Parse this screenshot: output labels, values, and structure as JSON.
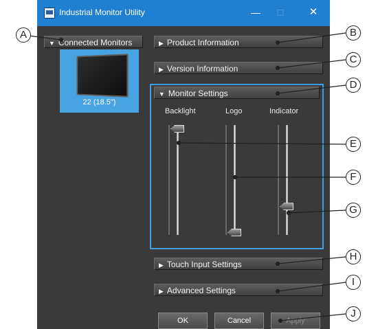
{
  "window": {
    "title": "Industrial Monitor Utility"
  },
  "window_controls": {
    "minimize": "—",
    "maximize": "□",
    "close": "✕"
  },
  "sections": {
    "connected_monitors": "Connected Monitors",
    "product_information": "Product Information",
    "version_information": "Version Information",
    "monitor_settings": "Monitor Settings",
    "touch_input_settings": "Touch Input Settings",
    "advanced_settings": "Advanced Settings"
  },
  "monitor": {
    "caption": "22 (18.5\")",
    "selected": true
  },
  "monitor_settings": {
    "sliders": [
      {
        "label": "Backlight",
        "level": 1.0
      },
      {
        "label": "Logo",
        "level": 0.0
      },
      {
        "label": "Indicator",
        "level": 0.25
      }
    ]
  },
  "buttons": {
    "ok": "OK",
    "cancel": "Cancel",
    "apply": "Apply"
  },
  "callouts": [
    "A",
    "B",
    "C",
    "D",
    "E",
    "F",
    "G",
    "H",
    "I",
    "J"
  ],
  "colors": {
    "titlebar": "#1f7fd0",
    "window_bg": "#3a3a3a",
    "highlight": "#3c9fe0",
    "tile": "#48a3e0"
  }
}
